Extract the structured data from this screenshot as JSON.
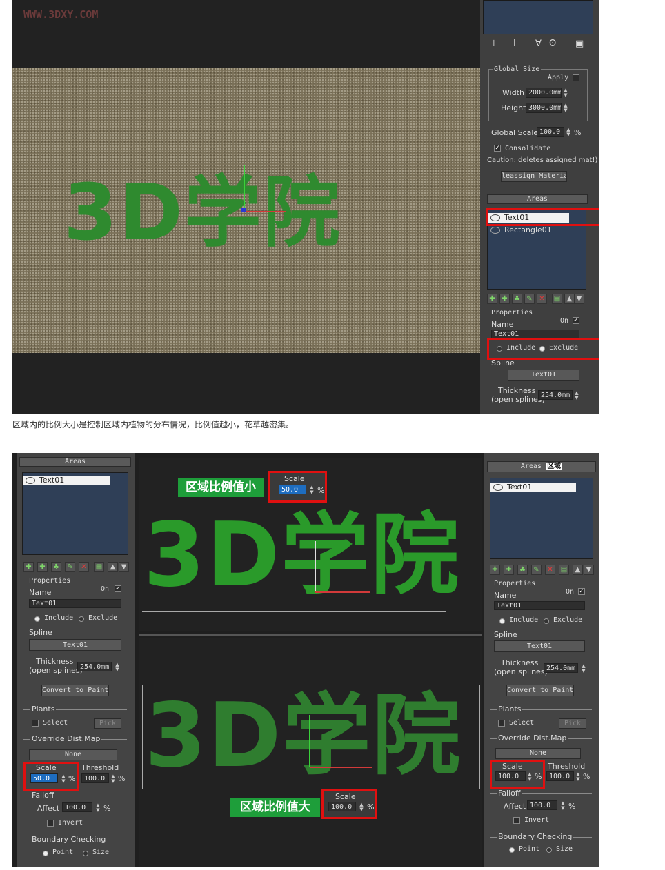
{
  "watermark": "WWW.3DXY.COM",
  "caption": "区域内的比例大小是控制区域内植物的分布情况，比例值越小，花草越密集。",
  "scene_text": "3D学院",
  "top": {
    "global_size": {
      "title": "Global Size",
      "apply_label": "Apply",
      "width_label": "Width",
      "width_value": "2000.0mm",
      "height_label": "Height",
      "height_value": "3000.0mm"
    },
    "global_scale_label": "Global Scale",
    "global_scale_value": "100.0",
    "percent": "%",
    "consolidate_label": "Consolidate",
    "caution_text": "Caution: deletes assigned mat!)",
    "reassign_label": "leassign Material",
    "areas_title": "Areas",
    "areas_items": [
      "Text01",
      "Rectangle01"
    ],
    "properties_title": "Properties",
    "name_label": "Name",
    "on_label": "On",
    "name_value": "Text01",
    "include_label": "Include",
    "exclude_label": "Exclude",
    "spline_label": "Spline",
    "spline_value": "Text01",
    "thickness_label": "Thickness",
    "thickness_sub": "(open splines)",
    "thickness_value": "254.0mm"
  },
  "bottom": {
    "left_panel": {
      "areas_title": "Areas",
      "areas_items": [
        "Text01"
      ],
      "properties_title": "Properties",
      "name_label": "Name",
      "on_label": "On",
      "name_value": "Text01",
      "include_label": "Include",
      "exclude_label": "Exclude",
      "spline_label": "Spline",
      "spline_value": "Text01",
      "thickness_label": "Thickness",
      "thickness_sub": "(open splines)",
      "thickness_value": "254.0mm",
      "convert_label": "Convert to Paint",
      "plants_label": "Plants",
      "select_label": "Select",
      "pick_label": "Pick",
      "override_label": "Override Dist.Map",
      "none_label": "None",
      "scale_label": "Scale",
      "scale_value": "50.0",
      "threshold_label": "Threshold",
      "threshold_value": "100.0",
      "falloff_label": "Falloff",
      "affect_label": "Affect",
      "affect_value": "100.0",
      "invert_label": "Invert",
      "boundary_label": "Boundary Checking",
      "point_label": "Point",
      "size_label": "Size"
    },
    "right_panel": {
      "areas_title": "Areas",
      "areas_cn": "区域",
      "areas_items": [
        "Text01"
      ],
      "properties_title": "Properties",
      "name_label": "Name",
      "on_label": "On",
      "name_value": "Text01",
      "include_label": "Include",
      "exclude_label": "Exclude",
      "spline_label": "Spline",
      "spline_value": "Text01",
      "thickness_label": "Thickness",
      "thickness_sub": "(open splines)",
      "thickness_value": "254.0mm",
      "convert_label": "Convert to Paint",
      "plants_label": "Plants",
      "select_label": "Select",
      "pick_label": "Pick",
      "override_label": "Override Dist.Map",
      "none_label": "None",
      "scale_label": "Scale",
      "scale_value": "100.0",
      "threshold_label": "Threshold",
      "threshold_value": "100.0",
      "falloff_label": "Falloff",
      "affect_label": "Affect",
      "affect_value": "100.0",
      "invert_label": "Invert",
      "boundary_label": "Boundary Checking",
      "point_label": "Point",
      "size_label": "Size"
    },
    "small_label": "区域比例值小",
    "large_label": "区域比例值大",
    "scale_small": {
      "label": "Scale",
      "value": "50.0"
    },
    "scale_large": {
      "label": "Scale",
      "value": "100.0"
    }
  },
  "colors": {
    "accent_red": "#e01010",
    "label_green": "#1e9e3a",
    "plant_green": "#2f8a2f",
    "panel_gray": "#444444",
    "list_blue": "#2f3f57"
  }
}
